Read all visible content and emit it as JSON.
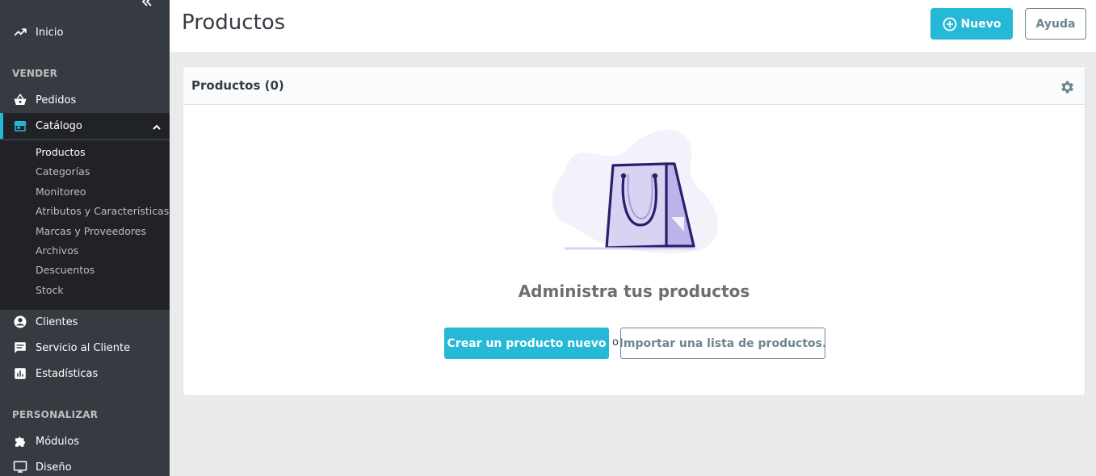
{
  "sidebar": {
    "collapse_icon": "double-chevron-left-icon",
    "items": [
      {
        "label": "Inicio",
        "icon": "trending-up-icon"
      },
      {
        "label": "Pedidos",
        "icon": "shopping-basket-icon"
      },
      {
        "label": "Catálogo",
        "icon": "store-icon"
      },
      {
        "label": "Clientes",
        "icon": "account-circle-icon"
      },
      {
        "label": "Servicio al Cliente",
        "icon": "chat-icon"
      },
      {
        "label": "Estadísticas",
        "icon": "bar-chart-icon"
      },
      {
        "label": "Módulos",
        "icon": "puzzle-icon"
      },
      {
        "label": "Diseño",
        "icon": "monitor-icon"
      }
    ],
    "sections": {
      "sell": "VENDER",
      "customize": "PERSONALIZAR"
    },
    "catalog_submenu": [
      {
        "label": "Productos",
        "active": true
      },
      {
        "label": "Categorías",
        "active": false
      },
      {
        "label": "Monitoreo",
        "active": false
      },
      {
        "label": "Atributos y Características",
        "active": false
      },
      {
        "label": "Marcas y Proveedores",
        "active": false
      },
      {
        "label": "Archivos",
        "active": false
      },
      {
        "label": "Descuentos",
        "active": false
      },
      {
        "label": "Stock",
        "active": false
      }
    ]
  },
  "header": {
    "title": "Productos",
    "new_button": "Nuevo",
    "help_button": "Ayuda"
  },
  "card": {
    "title": "Productos (0)",
    "empty_title": "Administra tus productos",
    "create_button": "Crear un producto nuevo",
    "or_text": "o",
    "import_button": "Importar una lista de productos."
  },
  "colors": {
    "sidebar_bg": "#363a41",
    "sidebar_active_bg": "#202226",
    "accent": "#25b9d7",
    "page_bg": "#eaebec",
    "illustration_purple": "#2e1d69",
    "illustration_light": "#d9d3f3"
  }
}
